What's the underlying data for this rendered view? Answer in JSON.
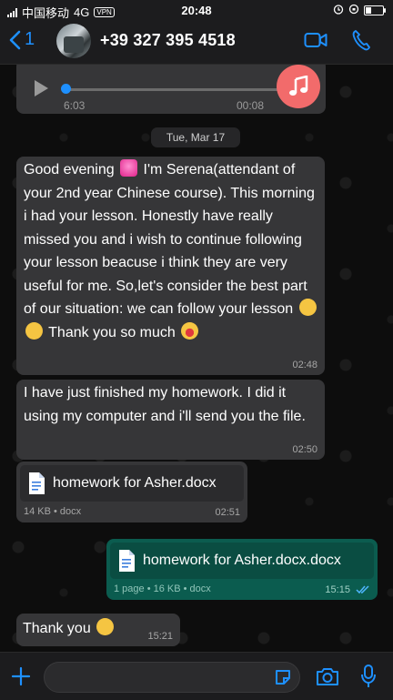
{
  "status": {
    "carrier": "中国移动",
    "network": "4G",
    "vpn": "VPN",
    "time": "20:48"
  },
  "header": {
    "back_count": "1",
    "contact": "+39 327 395 4518"
  },
  "audio": {
    "elapsed": "6:03",
    "duration": "00:08",
    "progress": 0
  },
  "date_separator": "Tue, Mar 17",
  "messages": {
    "m1": {
      "p1": "Good evening",
      "p2": "I'm Serena(attendant of your  2nd year Chinese course). This morning i had your lesson. Honestly have really missed you and i wish to continue following your lesson beacuse i think they are very useful for me. So,let's consider the best part of our situation: we can follow your lesson",
      "p3": "Thank you so much",
      "time": "02:48"
    },
    "m2": {
      "text": "I have just finished my homework. I did it using my computer and i'll send you the file.",
      "time": "02:50"
    },
    "m3": {
      "filename": "homework for Asher.docx",
      "meta": "14 KB • docx",
      "time": "02:51"
    },
    "m4": {
      "filename": "homework for Asher.docx.docx",
      "meta": "1 page • 16 KB • docx",
      "time": "15:15"
    },
    "m5": {
      "text": "Thank you",
      "time": "15:21"
    }
  },
  "colors": {
    "accent": "#1e90ff",
    "incoming_bubble": "#363638",
    "outgoing_bubble": "#0b5c4f",
    "audio_badge": "#f26b6b"
  },
  "icons": [
    "back-chevron-icon",
    "video-call-icon",
    "phone-icon",
    "play-icon",
    "music-note-icon",
    "document-icon",
    "read-ticks-icon",
    "plus-icon",
    "sticker-icon",
    "camera-icon",
    "microphone-icon"
  ]
}
